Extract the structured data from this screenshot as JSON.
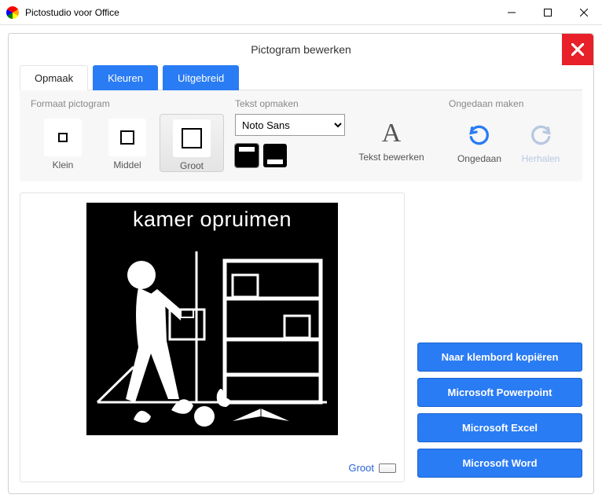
{
  "titlebar": {
    "app_name": "Pictostudio voor Office"
  },
  "panel": {
    "title": "Pictogram bewerken"
  },
  "tabs": {
    "opmaak": "Opmaak",
    "kleuren": "Kleuren",
    "uitgebreid": "Uitgebreid"
  },
  "groups": {
    "formaat_label": "Formaat pictogram",
    "tekst_label": "Tekst opmaken",
    "ongedaan_label": "Ongedaan maken"
  },
  "sizes": {
    "klein": "Klein",
    "middel": "Middel",
    "groot": "Groot"
  },
  "font": {
    "selected": "Noto Sans"
  },
  "actions": {
    "tekst_bewerken": "Tekst bewerken",
    "ongedaan": "Ongedaan",
    "herhalen": "Herhalen"
  },
  "preview": {
    "caption_label": "Groot",
    "picto_text": "kamer opruimen"
  },
  "buttons": {
    "clipboard": "Naar klembord kopiëren",
    "powerpoint": "Microsoft Powerpoint",
    "excel": "Microsoft Excel",
    "word": "Microsoft Word"
  }
}
